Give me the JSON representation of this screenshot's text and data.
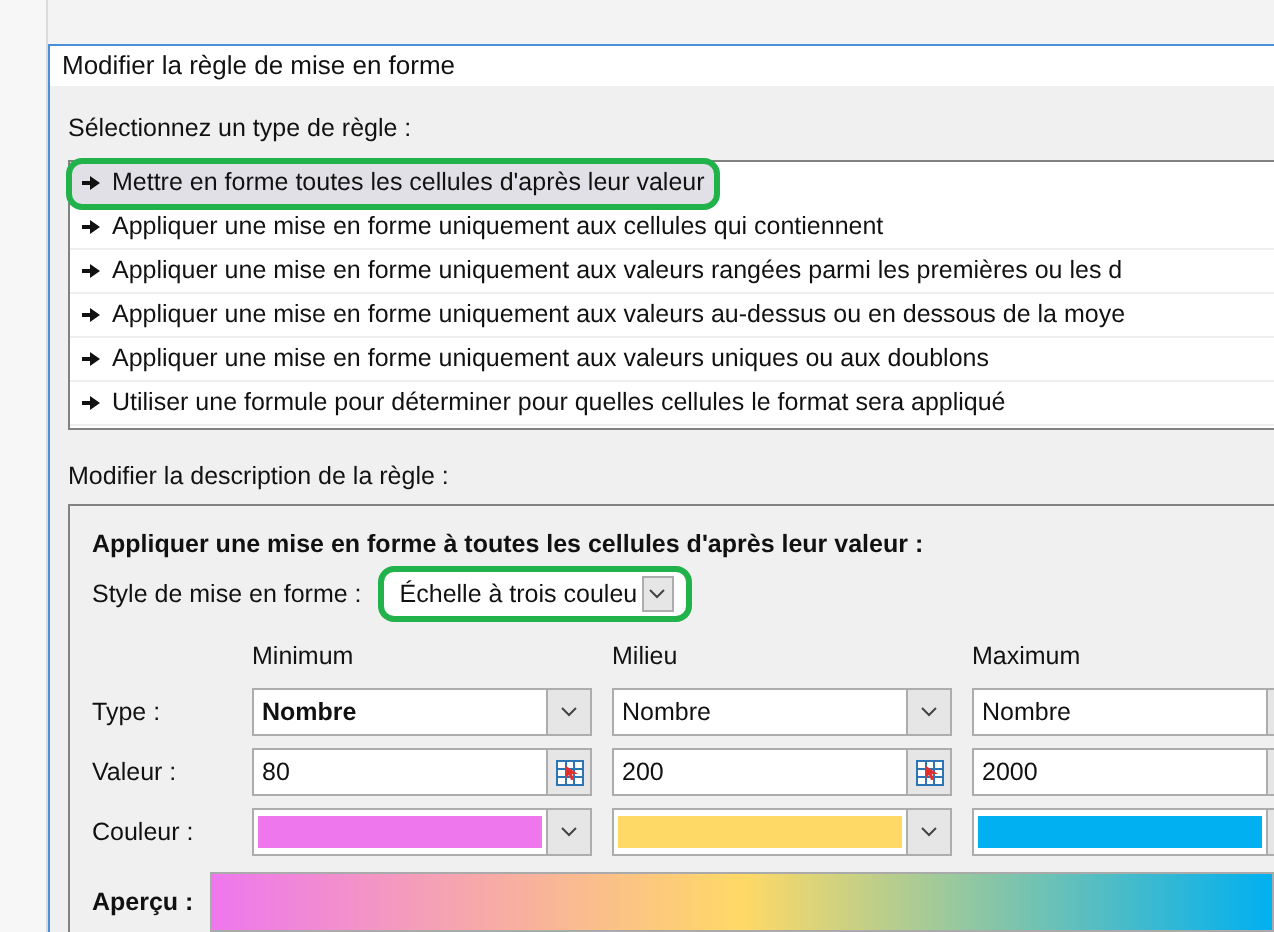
{
  "window": {
    "title": "Modifier la règle de mise en forme"
  },
  "rule_types": {
    "label": "Sélectionnez un type de règle :",
    "items": [
      {
        "label": "Mettre en forme toutes les cellules d'après leur valeur",
        "selected": true,
        "highlighted": true
      },
      {
        "label": "Appliquer une mise en forme uniquement aux cellules qui contiennent",
        "selected": false,
        "highlighted": false
      },
      {
        "label": "Appliquer une mise en forme uniquement aux valeurs rangées parmi les premières ou les d",
        "selected": false,
        "highlighted": false
      },
      {
        "label": "Appliquer une mise en forme uniquement aux valeurs au-dessus ou en dessous de la moye",
        "selected": false,
        "highlighted": false
      },
      {
        "label": "Appliquer une mise en forme uniquement aux valeurs uniques ou aux doublons",
        "selected": false,
        "highlighted": false
      },
      {
        "label": "Utiliser une formule pour déterminer pour quelles cellules le format sera appliqué",
        "selected": false,
        "highlighted": false
      }
    ]
  },
  "description": {
    "label": "Modifier la description de la règle :",
    "heading": "Appliquer une mise en forme à toutes les cellules d'après leur valeur :",
    "style": {
      "label": "Style de mise en forme :",
      "value": "Échelle à trois couleu",
      "highlighted": true
    },
    "row_labels": [
      "Type :",
      "Valeur :",
      "Couleur :"
    ],
    "columns": [
      {
        "header": "Minimum",
        "type": "Nombre",
        "type_bold": true,
        "value": "80",
        "color": "#ee77ee"
      },
      {
        "header": "Milieu",
        "type": "Nombre",
        "type_bold": false,
        "value": "200",
        "color": "#ffd966"
      },
      {
        "header": "Maximum",
        "type": "Nombre",
        "type_bold": false,
        "value": "2000",
        "color": "#00b0f0"
      }
    ],
    "preview_label": "Aperçu :"
  }
}
